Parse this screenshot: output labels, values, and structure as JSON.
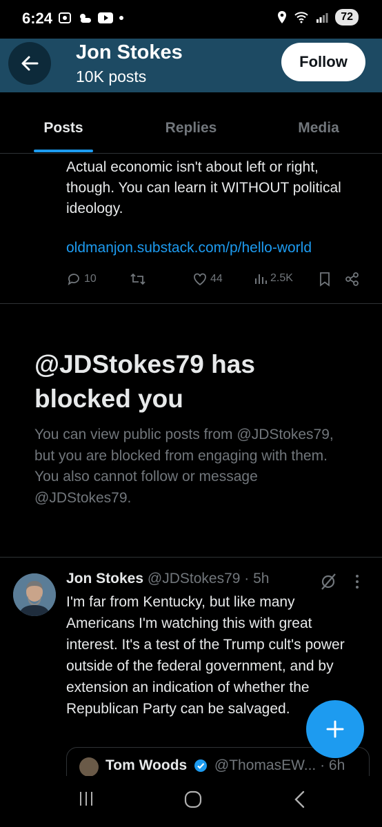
{
  "status_bar": {
    "time": "6:24",
    "battery": "72"
  },
  "header": {
    "name": "Jon Stokes",
    "post_count": "10K posts",
    "follow_label": "Follow"
  },
  "tabs": [
    {
      "label": "Posts",
      "active": true
    },
    {
      "label": "Replies",
      "active": false
    },
    {
      "label": "Media",
      "active": false
    }
  ],
  "post1": {
    "text": "Actual economic isn't about left or right, though.  You can learn it WITHOUT political ideology.",
    "link": "oldmanjon.substack.com/p/hello-world",
    "replies": "10",
    "likes": "44",
    "views": "2.5K"
  },
  "blocked": {
    "title": "@JDStokes79 has blocked you",
    "body": "You can view public posts from @JDStokes79, but you are blocked from engaging with them. You also cannot follow or message @JDStokes79."
  },
  "post2": {
    "name": "Jon Stokes",
    "handle": "@JDStokes79 · 5h",
    "text": "I'm far from Kentucky, but like many Americans I'm watching this with great interest.  It's a test of the Trump cult's power outside of the federal government, and by extension an indication of whether the Republican Party can be salvaged.",
    "quote": {
      "name": "Tom Woods",
      "handle": "@ThomasEW... · 6h"
    }
  },
  "colors": {
    "accent": "#1d9bf0",
    "header_bg": "#1d4a63",
    "muted": "#71767b"
  }
}
